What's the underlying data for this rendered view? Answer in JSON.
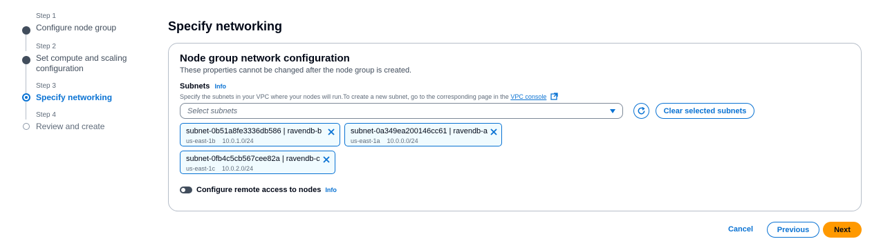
{
  "steps": [
    {
      "num": "Step 1",
      "title": "Configure node group",
      "state": "completed"
    },
    {
      "num": "Step 2",
      "title": "Set compute and scaling configuration",
      "state": "completed"
    },
    {
      "num": "Step 3",
      "title": "Specify networking",
      "state": "current"
    },
    {
      "num": "Step 4",
      "title": "Review and create",
      "state": "future"
    }
  ],
  "page": {
    "title": "Specify networking"
  },
  "panel": {
    "title": "Node group network configuration",
    "description": "These properties cannot be changed after the node group is created."
  },
  "subnets": {
    "label": "Subnets",
    "info": "Info",
    "description": "Specify the subnets in your VPC where your nodes will run.To create a new subnet, go to the corresponding page in the",
    "link_text": "VPC console",
    "placeholder": "Select subnets",
    "clear_label": "Clear selected subnets",
    "selected": [
      {
        "name": "subnet-0b51a8fe3336db586 | ravendb-b",
        "az": "us-east-1b",
        "cidr": "10.0.1.0/24"
      },
      {
        "name": "subnet-0a349ea200146cc61 | ravendb-a",
        "az": "us-east-1a",
        "cidr": "10.0.0.0/24"
      },
      {
        "name": "subnet-0fb4c5cb567cee82a | ravendb-c",
        "az": "us-east-1c",
        "cidr": "10.0.2.0/24"
      }
    ]
  },
  "remote_access": {
    "label": "Configure remote access to nodes",
    "info": "Info",
    "enabled": false
  },
  "footer": {
    "cancel": "Cancel",
    "previous": "Previous",
    "next": "Next"
  },
  "colors": {
    "accent": "#0972d3",
    "primary_button": "#ff9900",
    "text": "#000716"
  }
}
